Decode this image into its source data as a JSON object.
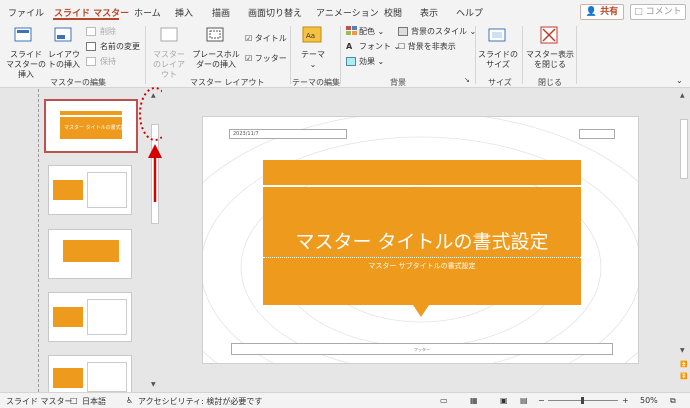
{
  "tabs": [
    "ファイル",
    "スライド マスター",
    "ホーム",
    "挿入",
    "描画",
    "画面切り替え",
    "アニメーション",
    "校閲",
    "表示",
    "ヘルプ"
  ],
  "share_label": "共有",
  "comment_label": "コメント",
  "ribbon": {
    "insert_slide_master": "スライド マスターの挿入",
    "insert_layout": "レイアウトの挿入",
    "delete": "削除",
    "rename": "名前の変更",
    "preserve": "保持",
    "group_edit_master": "マスターの編集",
    "master_layout": "マスターのレイアウト",
    "insert_placeholder": "プレースホルダーの挿入",
    "title_cb": "タイトル",
    "footer_cb": "フッター",
    "group_master_layout": "マスター レイアウト",
    "themes": "テーマ",
    "group_edit_theme": "テーマの編集",
    "colors": "配色",
    "fonts": "フォント",
    "effects": "効果",
    "bg_styles": "背景のスタイル",
    "hide_bg": "背景を非表示",
    "group_background": "背景",
    "slide_size": "スライドのサイズ",
    "group_size": "サイズ",
    "close_master": "マスター表示を閉じる",
    "group_close": "閉じる"
  },
  "slide": {
    "date": "2023/11/7",
    "title": "マスター タイトルの書式設定",
    "subtitle": "マスター サブタイトルの書式設定",
    "footer": "フッター"
  },
  "thumbs": {
    "master_title": "マスター タイトルの書式設定",
    "layout_title": "マスター タイトルの書式設定"
  },
  "status": {
    "view": "スライド マスター",
    "lang": "日本語",
    "accessibility": "アクセシビリティ: 検討が必要です",
    "zoom": "50%"
  },
  "colors": {
    "accent": "#b7472a",
    "orange": "#ee9a1c",
    "annotation": "#d40000"
  }
}
